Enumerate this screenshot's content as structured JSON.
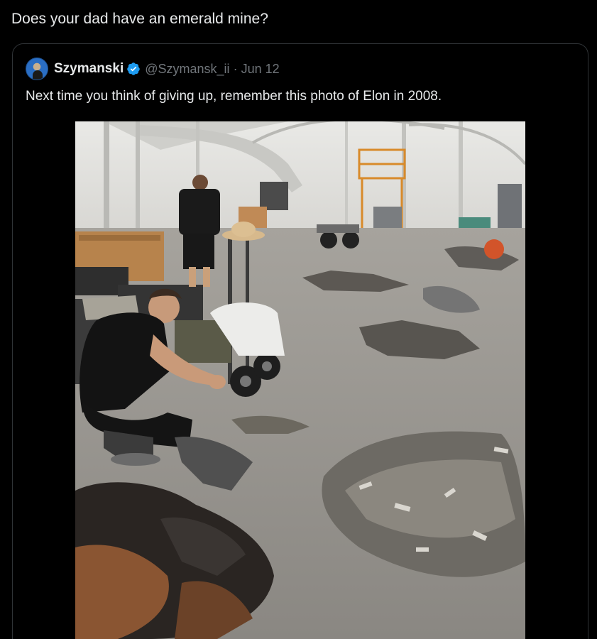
{
  "reply": {
    "text": "Does your dad have an emerald mine?"
  },
  "quoted_tweet": {
    "author_name": "Szymanski",
    "handle": "@Szymansk_ii",
    "separator": "·",
    "date": "Jun 12",
    "text": "Next time you think of giving up, remember this photo of Elon in 2008.",
    "verified_color": "#1d9bf0"
  },
  "colors": {
    "background": "#000000",
    "text": "#e7e9ea",
    "muted": "#71767b",
    "border": "#2f3336"
  }
}
